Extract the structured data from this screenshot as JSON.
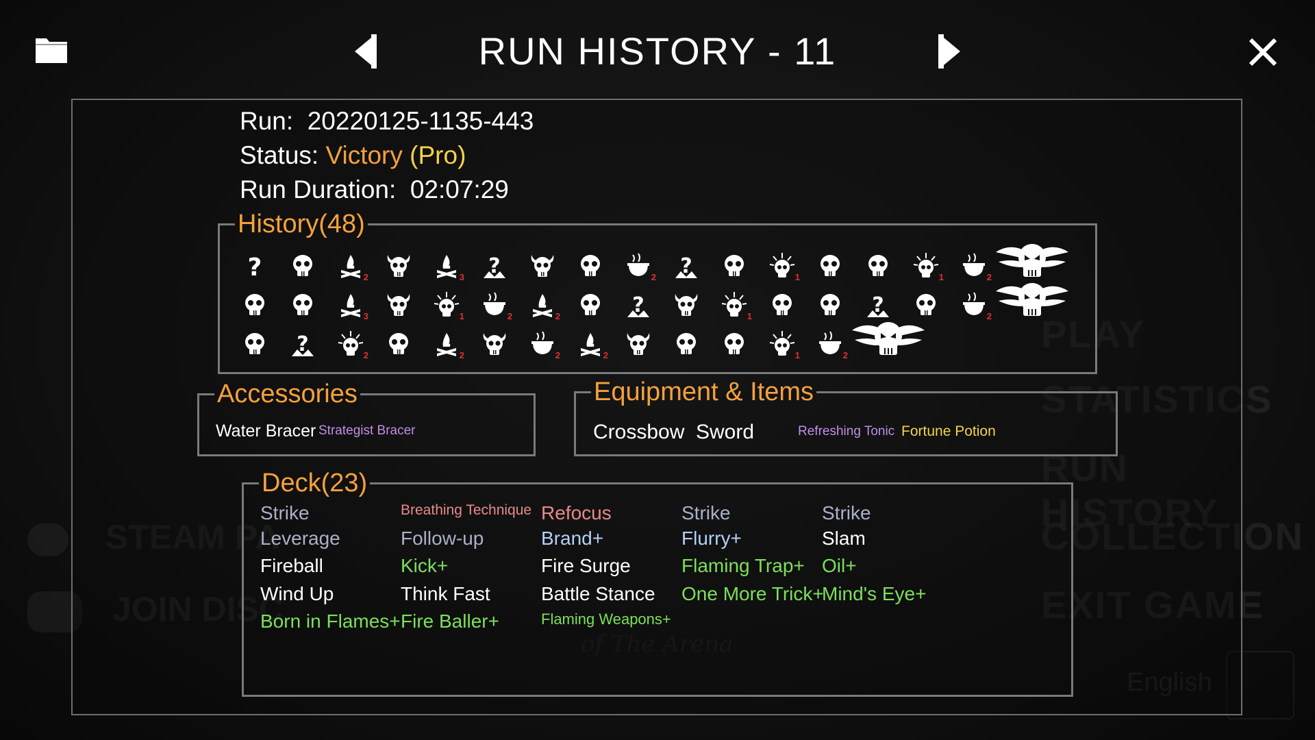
{
  "background_menu": {
    "items": [
      "PLAY",
      "STATISTICS",
      "RUN HISTORY",
      "COLLECTION",
      "EXIT GAME"
    ],
    "left_links": [
      "STEAM PA",
      "JOIN DISC"
    ],
    "language": "English",
    "art_subtitle": "of The Arena"
  },
  "topbar": {
    "title": "RUN HISTORY - 11"
  },
  "run_info": {
    "run_label": "Run:",
    "run_id": "20220125-1135-443",
    "status_label": "Status:",
    "status_value": "Victory",
    "status_mode": "(Pro)",
    "duration_label": "Run Duration:",
    "duration_value": "02:07:29"
  },
  "history": {
    "title": "History(48)",
    "rows": [
      [
        {
          "icon": "unknown-icon",
          "badge": ""
        },
        {
          "icon": "skull-icon",
          "badge": ""
        },
        {
          "icon": "campfire-icon",
          "badge": "2"
        },
        {
          "icon": "horned-skull-icon",
          "badge": ""
        },
        {
          "icon": "campfire-icon",
          "badge": "3"
        },
        {
          "icon": "event-icon",
          "badge": ""
        },
        {
          "icon": "horned-skull-icon",
          "badge": ""
        },
        {
          "icon": "skull-icon",
          "badge": ""
        },
        {
          "icon": "cauldron-icon",
          "badge": "2"
        },
        {
          "icon": "event-icon",
          "badge": ""
        },
        {
          "icon": "skull-icon",
          "badge": ""
        },
        {
          "icon": "spiky-skull-icon",
          "badge": "1"
        },
        {
          "icon": "skull-icon",
          "badge": ""
        },
        {
          "icon": "skull-icon",
          "badge": ""
        },
        {
          "icon": "spiky-skull-icon",
          "badge": "1"
        },
        {
          "icon": "cauldron-icon",
          "badge": "2"
        },
        {
          "icon": "boss-icon",
          "badge": ""
        }
      ],
      [
        {
          "icon": "skull-icon",
          "badge": ""
        },
        {
          "icon": "skull-icon",
          "badge": ""
        },
        {
          "icon": "campfire-icon",
          "badge": "3"
        },
        {
          "icon": "horned-skull-icon",
          "badge": ""
        },
        {
          "icon": "spiky-skull-icon",
          "badge": "1"
        },
        {
          "icon": "cauldron-icon",
          "badge": "2"
        },
        {
          "icon": "campfire-icon",
          "badge": "2"
        },
        {
          "icon": "skull-icon",
          "badge": ""
        },
        {
          "icon": "event-icon",
          "badge": ""
        },
        {
          "icon": "horned-skull-icon",
          "badge": ""
        },
        {
          "icon": "spiky-skull-icon",
          "badge": "1"
        },
        {
          "icon": "skull-icon",
          "badge": ""
        },
        {
          "icon": "skull-icon",
          "badge": ""
        },
        {
          "icon": "event-icon",
          "badge": ""
        },
        {
          "icon": "skull-icon",
          "badge": ""
        },
        {
          "icon": "cauldron-icon",
          "badge": "2"
        },
        {
          "icon": "boss-icon",
          "badge": ""
        }
      ],
      [
        {
          "icon": "skull-icon",
          "badge": ""
        },
        {
          "icon": "event-icon",
          "badge": ""
        },
        {
          "icon": "spiky-skull-icon",
          "badge": "2"
        },
        {
          "icon": "skull-icon",
          "badge": ""
        },
        {
          "icon": "campfire-icon",
          "badge": "2"
        },
        {
          "icon": "horned-skull-icon",
          "badge": ""
        },
        {
          "icon": "cauldron-icon",
          "badge": "2"
        },
        {
          "icon": "campfire-icon",
          "badge": "2"
        },
        {
          "icon": "horned-skull-icon",
          "badge": ""
        },
        {
          "icon": "skull-icon",
          "badge": ""
        },
        {
          "icon": "skull-icon",
          "badge": ""
        },
        {
          "icon": "spiky-skull-icon",
          "badge": "1"
        },
        {
          "icon": "cauldron-icon",
          "badge": "2"
        },
        {
          "icon": "boss-icon",
          "badge": ""
        }
      ]
    ]
  },
  "accessories": {
    "title": "Accessories",
    "items": [
      {
        "name": "Water Bracer",
        "color": "#ffffff"
      },
      {
        "name": "Strategist Bracer",
        "color": "#c18fe8"
      }
    ]
  },
  "equipment": {
    "title": "Equipment & Items",
    "items": [
      {
        "name": "Crossbow",
        "color": "#ffffff"
      },
      {
        "name": "Sword",
        "color": "#ffffff"
      },
      {
        "name": "Refreshing Tonic",
        "color": "#c18fe8"
      },
      {
        "name": "Fortune Potion",
        "color": "#f5d34a"
      }
    ]
  },
  "deck": {
    "title": "Deck(23)",
    "columns": [
      [
        {
          "name": "Strike",
          "rarity": "rare-dim"
        },
        {
          "name": "Leverage",
          "rarity": "rare-dim"
        },
        {
          "name": "Fireball",
          "rarity": "plain"
        },
        {
          "name": "Wind Up",
          "rarity": "plain"
        },
        {
          "name": "Born in Flames+",
          "rarity": "up"
        }
      ],
      [
        {
          "name": "Breathing Technique",
          "rarity": "red"
        },
        {
          "name": "Follow-up",
          "rarity": "rare-dim"
        },
        {
          "name": "Kick+",
          "rarity": "up"
        },
        {
          "name": "Think Fast",
          "rarity": "plain"
        },
        {
          "name": "Fire Baller+",
          "rarity": "up"
        }
      ],
      [
        {
          "name": "Refocus",
          "rarity": "red"
        },
        {
          "name": "Brand+",
          "rarity": "rare"
        },
        {
          "name": "Fire Surge",
          "rarity": "plain"
        },
        {
          "name": "Battle Stance",
          "rarity": "plain"
        },
        {
          "name": "Flaming Weapons+",
          "rarity": "up"
        }
      ],
      [
        {
          "name": "Strike",
          "rarity": "rare-dim"
        },
        {
          "name": "Flurry+",
          "rarity": "rare"
        },
        {
          "name": "Flaming Trap+",
          "rarity": "up"
        },
        {
          "name": "One More Trick+",
          "rarity": "up"
        }
      ],
      [
        {
          "name": "Strike",
          "rarity": "rare-dim"
        },
        {
          "name": "Slam",
          "rarity": "plain"
        },
        {
          "name": "Oil+",
          "rarity": "up"
        },
        {
          "name": "Mind's Eye+",
          "rarity": "up"
        }
      ]
    ]
  }
}
